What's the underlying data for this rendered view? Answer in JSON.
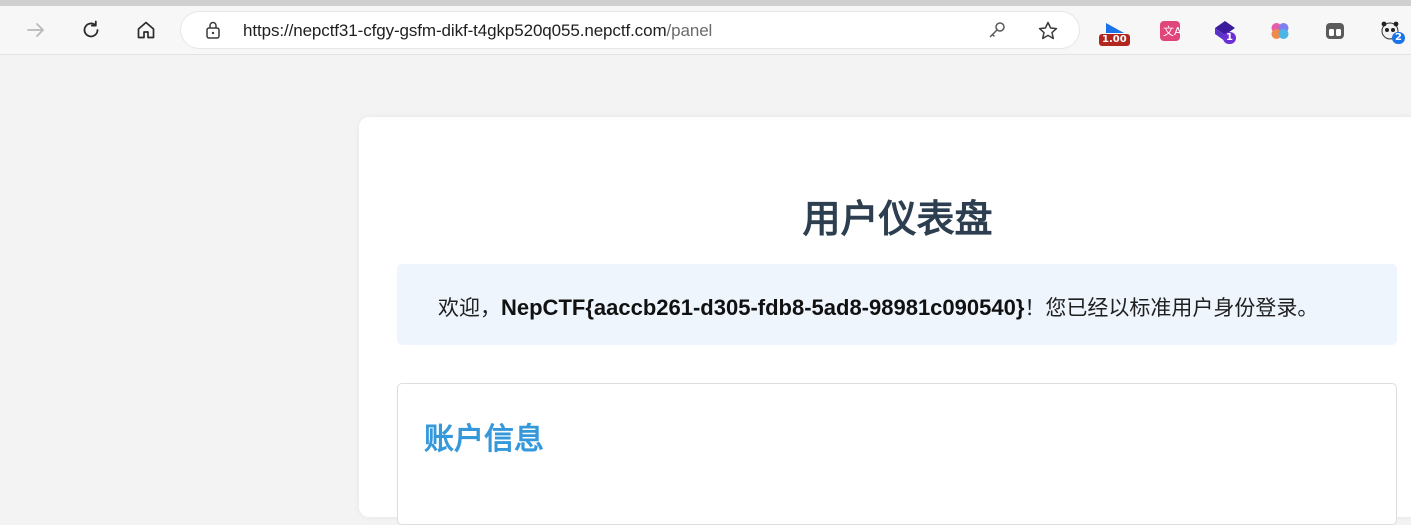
{
  "browser": {
    "url_main": "https://nepctf31-cfgy-gsfm-dikf-t4gkp520q055.nepctf.com",
    "url_path": "/panel",
    "icons": [
      "forward-icon",
      "refresh-icon",
      "home-icon",
      "lock-icon",
      "key-icon",
      "star-icon"
    ],
    "extensions": [
      {
        "name": "speed-extension-icon",
        "badge": "1.00",
        "color": "#b3261e"
      },
      {
        "name": "translate-extension-icon",
        "badge": "",
        "color": ""
      },
      {
        "name": "purple-extension-icon",
        "badge": "1",
        "color": "#6b2fd6"
      },
      {
        "name": "brain-extension-icon",
        "badge": "",
        "color": ""
      },
      {
        "name": "tab-extension-icon",
        "badge": "",
        "color": ""
      },
      {
        "name": "panda-extension-icon",
        "badge": "2",
        "color": "#1a73e8"
      }
    ]
  },
  "page": {
    "title": "用户仪表盘",
    "welcome_prefix": "欢迎，",
    "welcome_flag": "NepCTF{aaccb261-d305-fdb8-5ad8-98981c090540}",
    "welcome_suffix": "！您已经以标准用户身份登录。",
    "section_heading": "账户信息"
  },
  "colors": {
    "title": "#2c3e50",
    "section_heading": "#3498db",
    "welcome_bg": "#eef5fc"
  }
}
